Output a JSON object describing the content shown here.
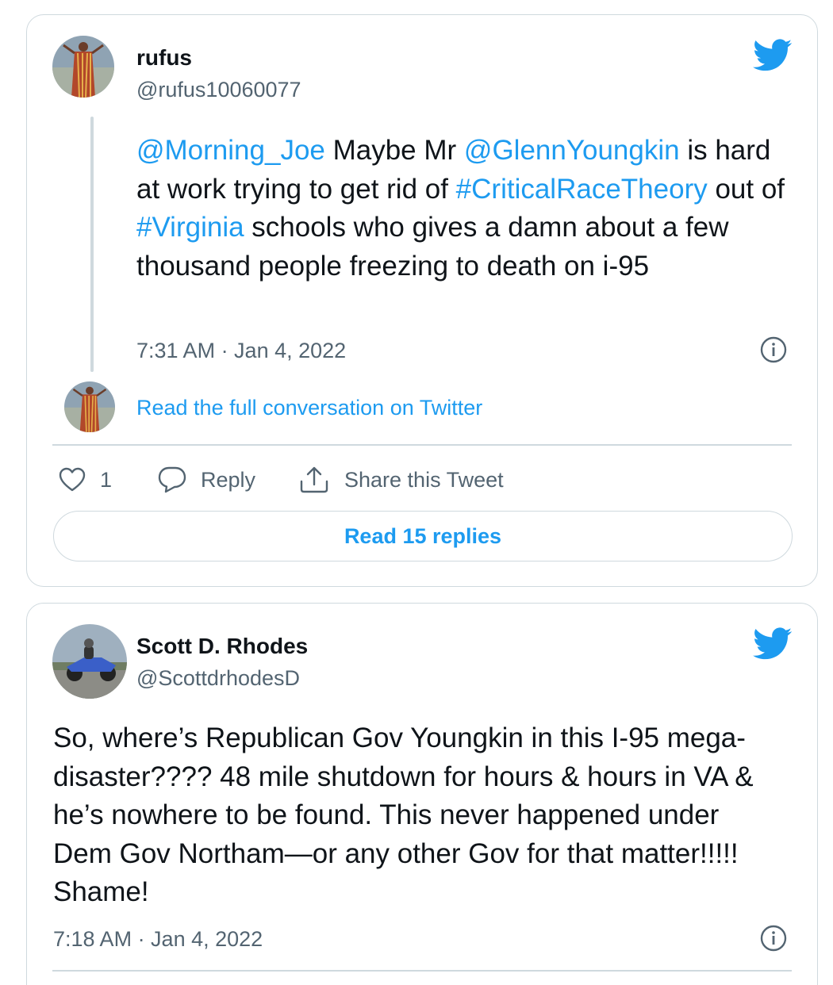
{
  "tweets": [
    {
      "name": "rufus",
      "handle": "@rufus10060077",
      "text_parts": {
        "m1": "@Morning_Joe",
        "t1": " Maybe Mr ",
        "m2": "@GlennYoungkin",
        "t2": " is hard at work trying to get rid of ",
        "h1": "#CriticalRaceTheory",
        "t3": " out of ",
        "h2": "#Virginia",
        "t4": " schools who gives a damn about a few thousand people freezing to death on i-95"
      },
      "timestamp": "7:31 AM · Jan 4, 2022",
      "read_full_label": "Read the full conversation on Twitter",
      "like_count": "1",
      "reply_label": "Reply",
      "share_label": "Share this Tweet",
      "read_replies_label": "Read 15 replies"
    },
    {
      "name": "Scott D. Rhodes",
      "handle": "@ScottdrhodesD",
      "text": "So, where’s Republican Gov Youngkin in this I-95 mega-disaster???? 48 mile shutdown for hours & hours in VA & he’s nowhere to be found. This never happened under Dem Gov Northam—or any other Gov for that matter!!!!! Shame!",
      "timestamp": "7:18 AM · Jan 4, 2022"
    }
  ],
  "icons": {
    "bird": "twitter-bird-icon",
    "info": "info-icon",
    "heart": "heart-icon",
    "reply": "reply-bubble-icon",
    "share": "share-upload-icon"
  },
  "colors": {
    "link": "#1d9bf0",
    "text": "#0f1419",
    "secondary": "#536471",
    "border": "#cfd9de"
  }
}
